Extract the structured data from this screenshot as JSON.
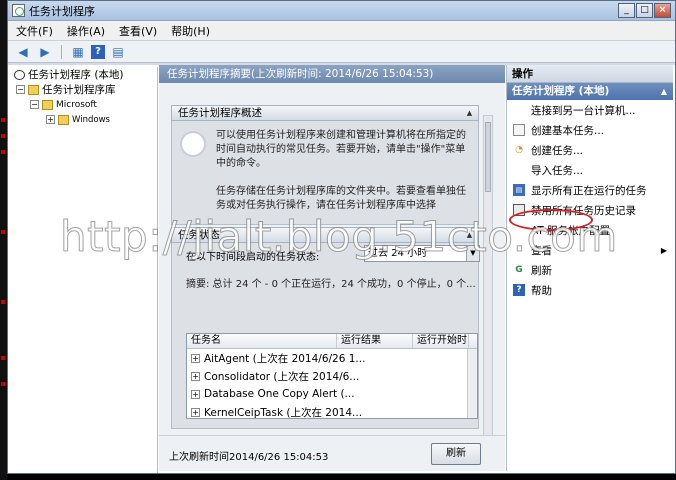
{
  "window": {
    "title": "任务计划程序"
  },
  "menu": [
    "文件(F)",
    "操作(A)",
    "查看(V)",
    "帮助(H)"
  ],
  "tree": {
    "root": "任务计划程序 (本地)",
    "library": "任务计划程序库",
    "microsoft": "Microsoft",
    "windows": "Windows"
  },
  "center": {
    "header": "任务计划程序摘要(上次刷新时间: 2014/6/26 15:04:53)",
    "overview_title": "任务计划程序概述",
    "overview_text": "可以使用任务计划程序来创建和管理计算机将在所指定的时间自动执行的常见任务。若要开始，请单击\"操作\"菜单中的命令。",
    "overview_text2": "任务存储在任务计划程序库的文件夹中。若要查看单独任务或对任务执行操作，请在任务计划程序库中选择",
    "status_title": "任务状态",
    "status_label": "在以下时间段启动的任务状态:",
    "status_select": "过去 24 小时",
    "summary": "摘要: 总计 24 个 - 0 个正在运行，24 个成功，0 个停止，0 个...",
    "table_headers": [
      "任务名",
      "运行结果",
      "运行开始时"
    ],
    "rows": [
      "AitAgent (上次在 2014/6/26 1...",
      "Consolidator (上次在 2014/6...",
      "Database One Copy Alert (...",
      "KernelCeipTask (上次在 2014..."
    ],
    "footer": "上次刷新时间2014/6/26 15:04:53",
    "refresh": "刷新"
  },
  "actions": {
    "header": "操作",
    "sub": "任务计划程序 (本地)",
    "items": [
      "连接到另一台计算机...",
      "创建基本任务...",
      "创建任务...",
      "导入任务...",
      "显示所有正在运行的任务",
      "禁用所有任务历史记录",
      "AT 服务帐户配置",
      "查看",
      "刷新",
      "帮助"
    ]
  },
  "watermark": "http://jialt.blog.51cto.com",
  "colors": {
    "highlight": "#d42020",
    "header_blue": "#4d72ab"
  }
}
